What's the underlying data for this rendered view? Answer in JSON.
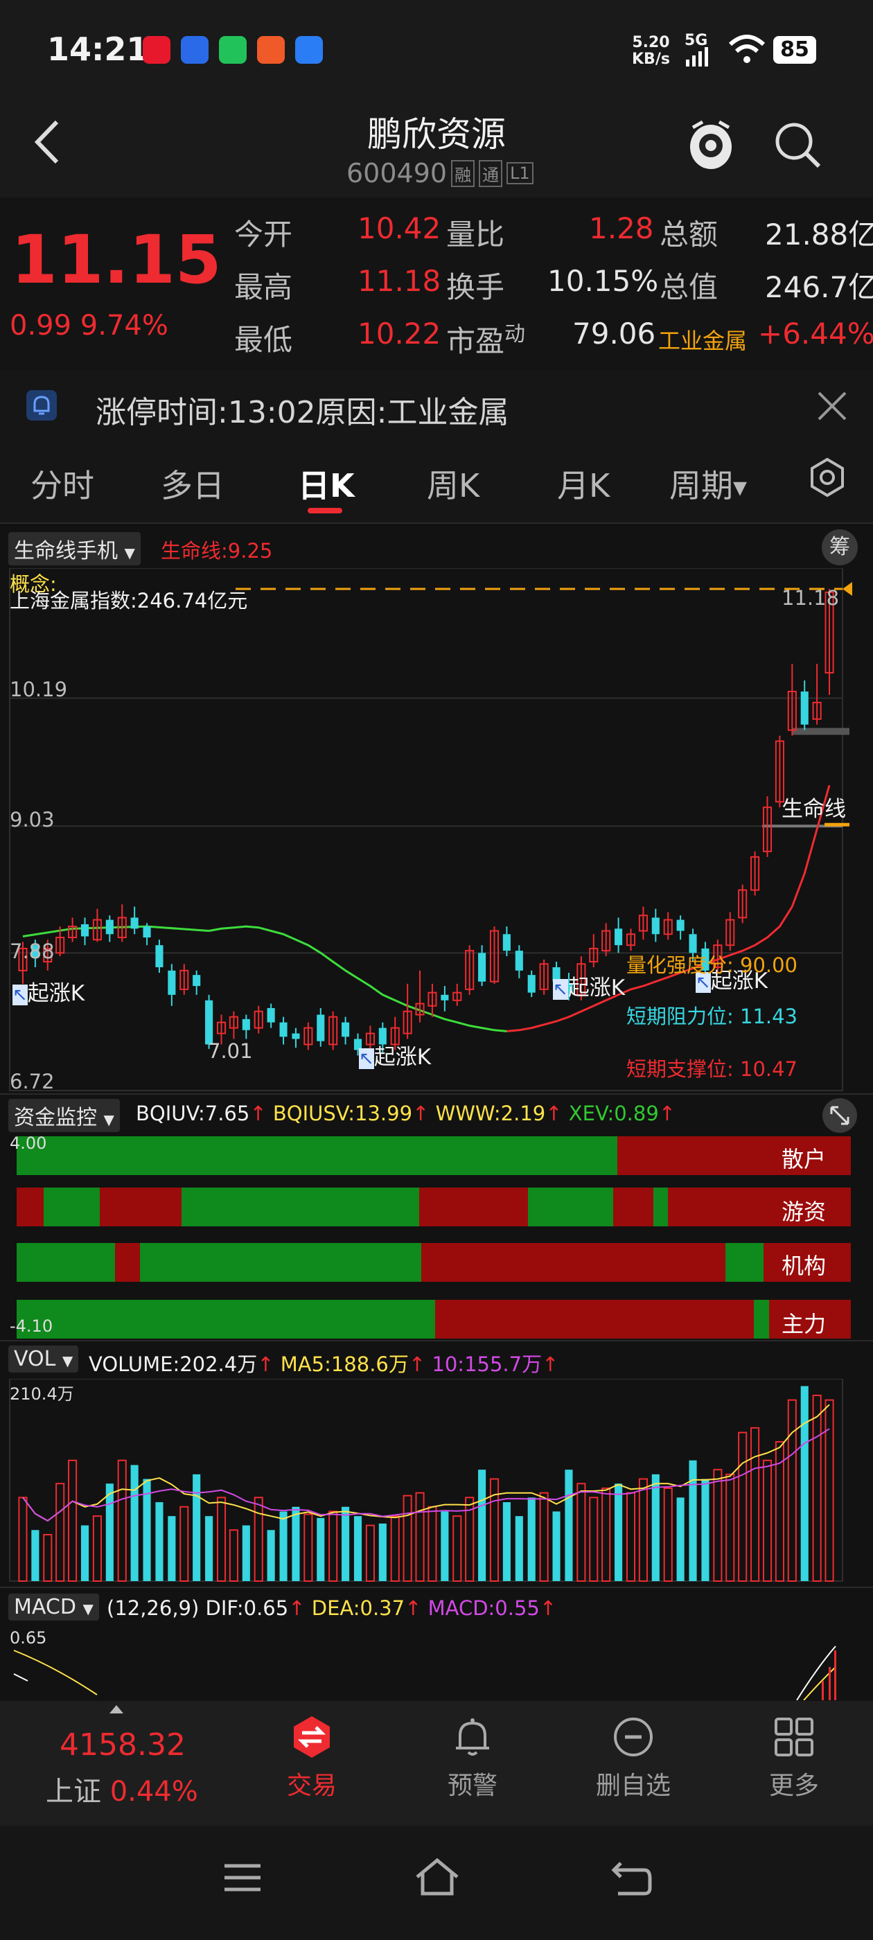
{
  "status_bar": {
    "time": "14:21",
    "net_speed_value": "5.20",
    "net_speed_unit": "KB/s",
    "signal_label": "5G",
    "battery": "85"
  },
  "header": {
    "stock_name": "鹏欣资源",
    "stock_code": "600490",
    "badges": [
      "融",
      "通",
      "L1"
    ]
  },
  "quote": {
    "price": "11.15",
    "change": "0.99",
    "change_pct": "9.74%",
    "rows": [
      [
        {
          "label": "今开",
          "value": "10.42"
        },
        {
          "label": "量比",
          "value": "1.28"
        },
        {
          "label": "总额",
          "value": "21.88亿"
        }
      ],
      [
        {
          "label": "最高",
          "value": "11.18"
        },
        {
          "label": "换手",
          "value": "10.15%"
        },
        {
          "label": "总值",
          "value": "246.7亿"
        }
      ],
      [
        {
          "label": "最低",
          "value": "10.22"
        },
        {
          "label": "市盈",
          "value": "79.06"
        },
        {
          "label": "工业金属",
          "value": "+6.44%"
        }
      ]
    ],
    "pe_superscript": "动"
  },
  "banner": {
    "text": "涨停时间:13:02原因:工业金属"
  },
  "tabs": [
    "分时",
    "多日",
    "日K",
    "周K",
    "月K",
    "周期"
  ],
  "active_tab": "日K",
  "main_chart": {
    "indicator_name": "生命线手机",
    "indicator_value": "生命线:9.25",
    "right_button": "筹",
    "concept_label": "概念:",
    "overlay_text": "上海金属指数:246.74亿元",
    "price_labels": [
      "10.19",
      "9.03",
      "7.88",
      "6.72"
    ],
    "high_label": "11.18",
    "low_label": "7.01",
    "lifeline_label": "生命线",
    "signal_label": "起涨K",
    "quant_strength": "量化强度分: 90.00",
    "resistance": "短期阻力位: 11.43",
    "support": "短期支撑位: 10.47"
  },
  "fund_panel": {
    "name": "资金监控",
    "bqiuv": "BQIUV:7.65",
    "bqiusv": "BQIUSV:13.99",
    "www": "WWW:2.19",
    "xev": "XEV:0.89",
    "top_value": "4.00",
    "bottom_value": "-4.10",
    "rows": [
      "散户",
      "游资",
      "机构",
      "主力"
    ]
  },
  "vol_panel": {
    "name": "VOL",
    "volume": "VOLUME:202.4万",
    "ma5": "MA5:188.6万",
    "ma10": "10:155.7万",
    "max_label": "210.4万"
  },
  "macd_panel": {
    "name": "MACD",
    "params": "(12,26,9)",
    "dif": "DIF:0.65",
    "dea": "DEA:0.37",
    "macd": "MACD:0.55",
    "top_value": "0.65"
  },
  "bottom_nav": {
    "index_value": "4158.32",
    "index_name": "上证",
    "index_change": "0.44%",
    "items": [
      "交易",
      "预警",
      "删自选",
      "更多"
    ]
  },
  "colors": {
    "up": "#ee2b30",
    "down": "#37d6e0",
    "green_band": "#0f8a1c",
    "red_band": "#9a0b0b",
    "background": "#121212",
    "accent_orange": "#f3a30e"
  },
  "chart_data": {
    "type": "candlestick",
    "y_range": [
      6.72,
      11.18
    ],
    "candles": [
      {
        "o": 7.72,
        "c": 7.92,
        "h": 7.98,
        "l": 7.6
      },
      {
        "o": 7.95,
        "c": 7.84,
        "h": 8.0,
        "l": 7.75
      },
      {
        "o": 7.8,
        "c": 7.92,
        "h": 8.0,
        "l": 7.72
      },
      {
        "o": 7.88,
        "c": 8.02,
        "h": 8.12,
        "l": 7.85
      },
      {
        "o": 8.02,
        "c": 8.12,
        "h": 8.2,
        "l": 7.98
      },
      {
        "o": 8.14,
        "c": 8.03,
        "h": 8.2,
        "l": 7.95
      },
      {
        "o": 8.0,
        "c": 8.18,
        "h": 8.28,
        "l": 7.98
      },
      {
        "o": 8.18,
        "c": 8.05,
        "h": 8.22,
        "l": 7.98
      },
      {
        "o": 8.02,
        "c": 8.2,
        "h": 8.32,
        "l": 7.98
      },
      {
        "o": 8.2,
        "c": 8.1,
        "h": 8.3,
        "l": 8.05
      },
      {
        "o": 8.12,
        "c": 8.02,
        "h": 8.15,
        "l": 7.95
      },
      {
        "o": 7.95,
        "c": 7.75,
        "h": 8.0,
        "l": 7.7
      },
      {
        "o": 7.72,
        "c": 7.5,
        "h": 7.78,
        "l": 7.4
      },
      {
        "o": 7.55,
        "c": 7.72,
        "h": 7.78,
        "l": 7.5
      },
      {
        "o": 7.68,
        "c": 7.58,
        "h": 7.72,
        "l": 7.5
      },
      {
        "o": 7.45,
        "c": 7.05,
        "h": 7.5,
        "l": 7.01
      },
      {
        "o": 7.15,
        "c": 7.25,
        "h": 7.32,
        "l": 7.05
      },
      {
        "o": 7.2,
        "c": 7.3,
        "h": 7.35,
        "l": 7.1
      },
      {
        "o": 7.28,
        "c": 7.18,
        "h": 7.32,
        "l": 7.1
      },
      {
        "o": 7.2,
        "c": 7.35,
        "h": 7.4,
        "l": 7.15
      },
      {
        "o": 7.38,
        "c": 7.25,
        "h": 7.42,
        "l": 7.2
      },
      {
        "o": 7.25,
        "c": 7.12,
        "h": 7.3,
        "l": 7.05
      },
      {
        "o": 7.15,
        "c": 7.1,
        "h": 7.2,
        "l": 7.02
      },
      {
        "o": 7.05,
        "c": 7.2,
        "h": 7.25,
        "l": 7.0
      },
      {
        "o": 7.32,
        "c": 7.08,
        "h": 7.38,
        "l": 7.03
      },
      {
        "o": 7.05,
        "c": 7.3,
        "h": 7.35,
        "l": 7.0
      },
      {
        "o": 7.25,
        "c": 7.12,
        "h": 7.3,
        "l": 7.05
      },
      {
        "o": 7.1,
        "c": 7.0,
        "h": 7.15,
        "l": 6.95
      },
      {
        "o": 7.05,
        "c": 7.15,
        "h": 7.22,
        "l": 7.0
      },
      {
        "o": 7.2,
        "c": 7.05,
        "h": 7.25,
        "l": 6.98
      },
      {
        "o": 7.05,
        "c": 7.2,
        "h": 7.3,
        "l": 7.0
      },
      {
        "o": 7.15,
        "c": 7.35,
        "h": 7.6,
        "l": 7.1
      },
      {
        "o": 7.32,
        "c": 7.42,
        "h": 7.72,
        "l": 7.25
      },
      {
        "o": 7.4,
        "c": 7.52,
        "h": 7.6,
        "l": 7.3
      },
      {
        "o": 7.5,
        "c": 7.45,
        "h": 7.58,
        "l": 7.35
      },
      {
        "o": 7.45,
        "c": 7.52,
        "h": 7.6,
        "l": 7.4
      },
      {
        "o": 7.55,
        "c": 7.9,
        "h": 7.95,
        "l": 7.5
      },
      {
        "o": 7.88,
        "c": 7.62,
        "h": 7.95,
        "l": 7.58
      },
      {
        "o": 7.62,
        "c": 8.08,
        "h": 8.12,
        "l": 7.6
      },
      {
        "o": 8.05,
        "c": 7.9,
        "h": 8.12,
        "l": 7.85
      },
      {
        "o": 7.9,
        "c": 7.72,
        "h": 7.95,
        "l": 7.65
      },
      {
        "o": 7.68,
        "c": 7.52,
        "h": 7.72,
        "l": 7.48
      },
      {
        "o": 7.55,
        "c": 7.78,
        "h": 7.82,
        "l": 7.5
      },
      {
        "o": 7.75,
        "c": 7.62,
        "h": 7.8,
        "l": 7.55
      },
      {
        "o": 7.6,
        "c": 7.52,
        "h": 7.7,
        "l": 7.45
      },
      {
        "o": 7.5,
        "c": 7.78,
        "h": 7.85,
        "l": 7.45
      },
      {
        "o": 7.8,
        "c": 7.92,
        "h": 8.05,
        "l": 7.75
      },
      {
        "o": 7.9,
        "c": 8.08,
        "h": 8.15,
        "l": 7.85
      },
      {
        "o": 8.1,
        "c": 7.95,
        "h": 8.2,
        "l": 7.88
      },
      {
        "o": 7.95,
        "c": 8.05,
        "h": 8.1,
        "l": 7.9
      },
      {
        "o": 8.08,
        "c": 8.22,
        "h": 8.3,
        "l": 8.0
      },
      {
        "o": 8.2,
        "c": 8.05,
        "h": 8.28,
        "l": 7.98
      },
      {
        "o": 8.05,
        "c": 8.18,
        "h": 8.25,
        "l": 8.0
      },
      {
        "o": 8.18,
        "c": 8.08,
        "h": 8.22,
        "l": 8.0
      },
      {
        "o": 8.05,
        "c": 7.88,
        "h": 8.1,
        "l": 7.8
      },
      {
        "o": 7.92,
        "c": 7.72,
        "h": 7.98,
        "l": 7.68
      },
      {
        "o": 7.75,
        "c": 7.95,
        "h": 8.0,
        "l": 7.7
      },
      {
        "o": 7.95,
        "c": 8.18,
        "h": 8.25,
        "l": 7.9
      },
      {
        "o": 8.2,
        "c": 8.45,
        "h": 8.5,
        "l": 8.15
      },
      {
        "o": 8.45,
        "c": 8.75,
        "h": 8.8,
        "l": 8.4
      },
      {
        "o": 8.8,
        "c": 9.2,
        "h": 9.3,
        "l": 8.75
      },
      {
        "o": 9.25,
        "c": 9.8,
        "h": 9.85,
        "l": 9.2
      },
      {
        "o": 9.9,
        "c": 10.25,
        "h": 10.5,
        "l": 9.85
      },
      {
        "o": 10.25,
        "c": 9.95,
        "h": 10.35,
        "l": 9.9
      },
      {
        "o": 10.0,
        "c": 10.15,
        "h": 10.5,
        "l": 9.95
      },
      {
        "o": 10.42,
        "c": 11.15,
        "h": 11.18,
        "l": 10.22
      }
    ],
    "volume": [
      90,
      55,
      50,
      105,
      130,
      60,
      70,
      105,
      130,
      125,
      110,
      85,
      70,
      80,
      115,
      70,
      90,
      55,
      60,
      90,
      55,
      75,
      80,
      72,
      68,
      75,
      80,
      70,
      60,
      62,
      70,
      92,
      95,
      80,
      75,
      70,
      90,
      120,
      110,
      85,
      70,
      90,
      95,
      75,
      120,
      105,
      90,
      100,
      105,
      95,
      110,
      115,
      100,
      90,
      130,
      110,
      120,
      115,
      160,
      165,
      130,
      150,
      195,
      210,
      200,
      195
    ],
    "lifeline": [
      8.08,
      8.1,
      8.11,
      8.12,
      8.11,
      8.08,
      8.05,
      8.0,
      7.95,
      7.88,
      7.8,
      7.72,
      7.65,
      7.58,
      7.5,
      7.45,
      7.4,
      7.36,
      7.32,
      7.28,
      7.25,
      7.22,
      7.2,
      7.18,
      7.17,
      7.18,
      7.2,
      7.23,
      7.26,
      7.3,
      7.35,
      7.4,
      7.45,
      7.5,
      7.55,
      7.58,
      7.62,
      7.66,
      7.7,
      7.74,
      7.78,
      7.82,
      7.86,
      7.9,
      7.95,
      8.02,
      8.12,
      8.3,
      8.6,
      9.0,
      9.4
    ],
    "fund_rows": {
      "散户": [
        {
          "c": "g",
          "w": 0.72
        },
        {
          "c": "r",
          "w": 0.28
        }
      ],
      "游资": [
        {
          "c": "r",
          "w": 0.032
        },
        {
          "c": "g",
          "w": 0.068
        },
        {
          "c": "r",
          "w": 0.098
        },
        {
          "c": "g",
          "w": 0.285
        },
        {
          "c": "r",
          "w": 0.13
        },
        {
          "c": "g",
          "w": 0.102
        },
        {
          "c": "r",
          "w": 0.048
        },
        {
          "c": "g",
          "w": 0.018
        },
        {
          "c": "r",
          "w": 0.219
        }
      ],
      "机构": [
        {
          "c": "g",
          "w": 0.118
        },
        {
          "c": "r",
          "w": 0.03
        },
        {
          "c": "g",
          "w": 0.337
        },
        {
          "c": "r",
          "w": 0.365
        },
        {
          "c": "g",
          "w": 0.045
        },
        {
          "c": "r",
          "w": 0.105
        }
      ],
      "主力": [
        {
          "c": "g",
          "w": 0.502
        },
        {
          "c": "r",
          "w": 0.382
        },
        {
          "c": "g",
          "w": 0.018
        },
        {
          "c": "r",
          "w": 0.098
        }
      ]
    }
  }
}
